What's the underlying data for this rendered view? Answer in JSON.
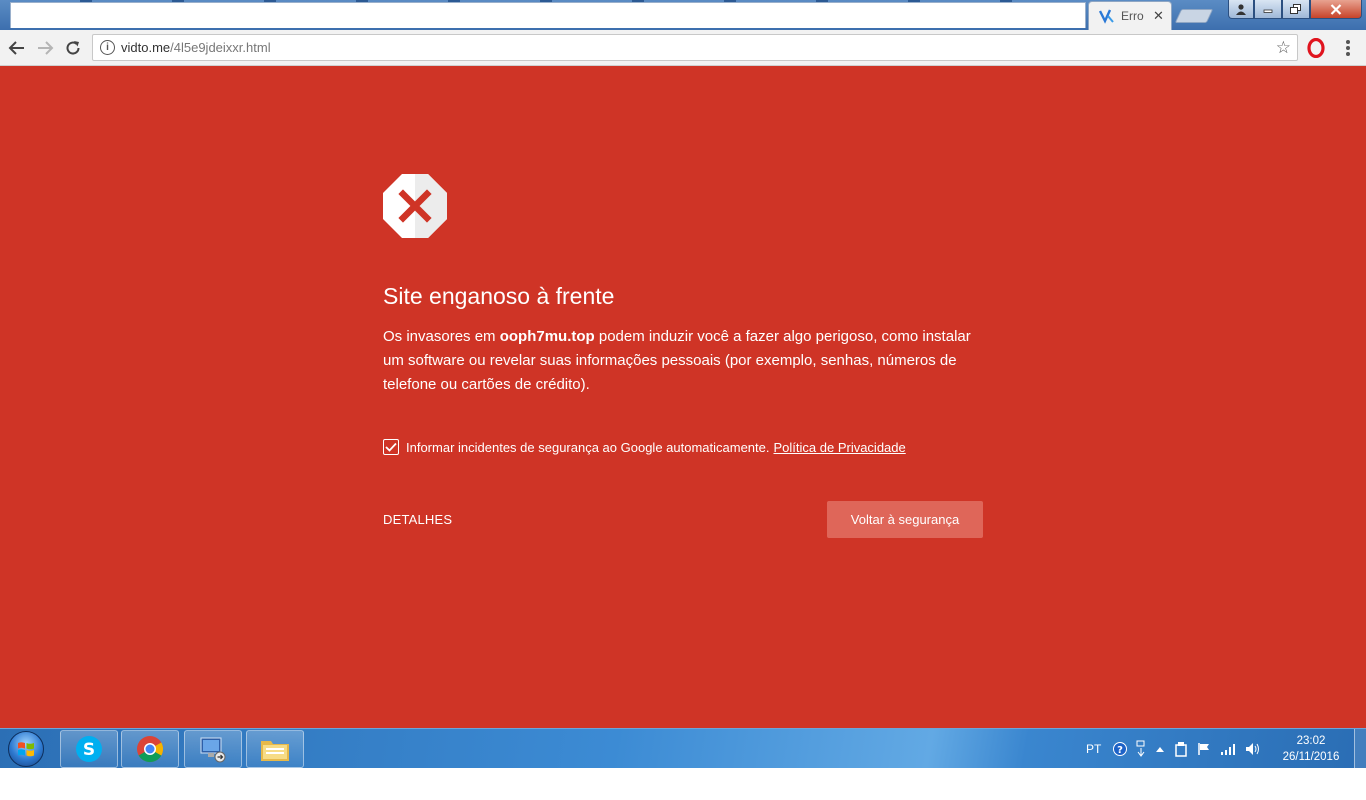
{
  "browser": {
    "tab": {
      "title": "Erro",
      "close_glyph": "✕"
    },
    "url": {
      "host": "vidto.me",
      "path": "/4l5e9jdeixxr.html"
    },
    "icons": {
      "back": "arrow-left-icon",
      "forward": "arrow-right-icon",
      "reload": "reload-icon",
      "info": "info-icon",
      "bookmark": "star-icon",
      "extension": "opera-icon",
      "menu": "kebab-menu-icon"
    },
    "window_buttons": [
      "user-icon",
      "minimize-icon",
      "maximize-icon",
      "close-icon"
    ]
  },
  "interstitial": {
    "heading": "Site enganoso à frente",
    "desc_before": "Os invasores em ",
    "desc_domain": "ooph7mu.top",
    "desc_after": " podem induzir você a fazer algo perigoso, como instalar um software ou revelar suas informações pessoais (por exemplo, senhas, números de telefone ou cartões de crédito).",
    "report_label": "Informar incidentes de segurança ao Google automaticamente.",
    "report_checked": true,
    "privacy_link": "Política de Privacidade",
    "details_button": "DETALHES",
    "primary_button": "Voltar à segurança",
    "colors": {
      "background": "#cf3426",
      "primary_button": "#df6659",
      "icon_x": "#cf3426"
    }
  },
  "taskbar": {
    "pinned": [
      "skype-icon",
      "chrome-icon",
      "remote-desktop-icon",
      "file-explorer-icon"
    ],
    "tray": {
      "language": "PT",
      "icons": [
        "help-icon",
        "network-switch-icon",
        "show-hidden-icon",
        "device-icon",
        "action-center-flag-icon",
        "signal-icon",
        "volume-icon"
      ]
    },
    "time": "23:02",
    "date": "26/11/2016"
  }
}
